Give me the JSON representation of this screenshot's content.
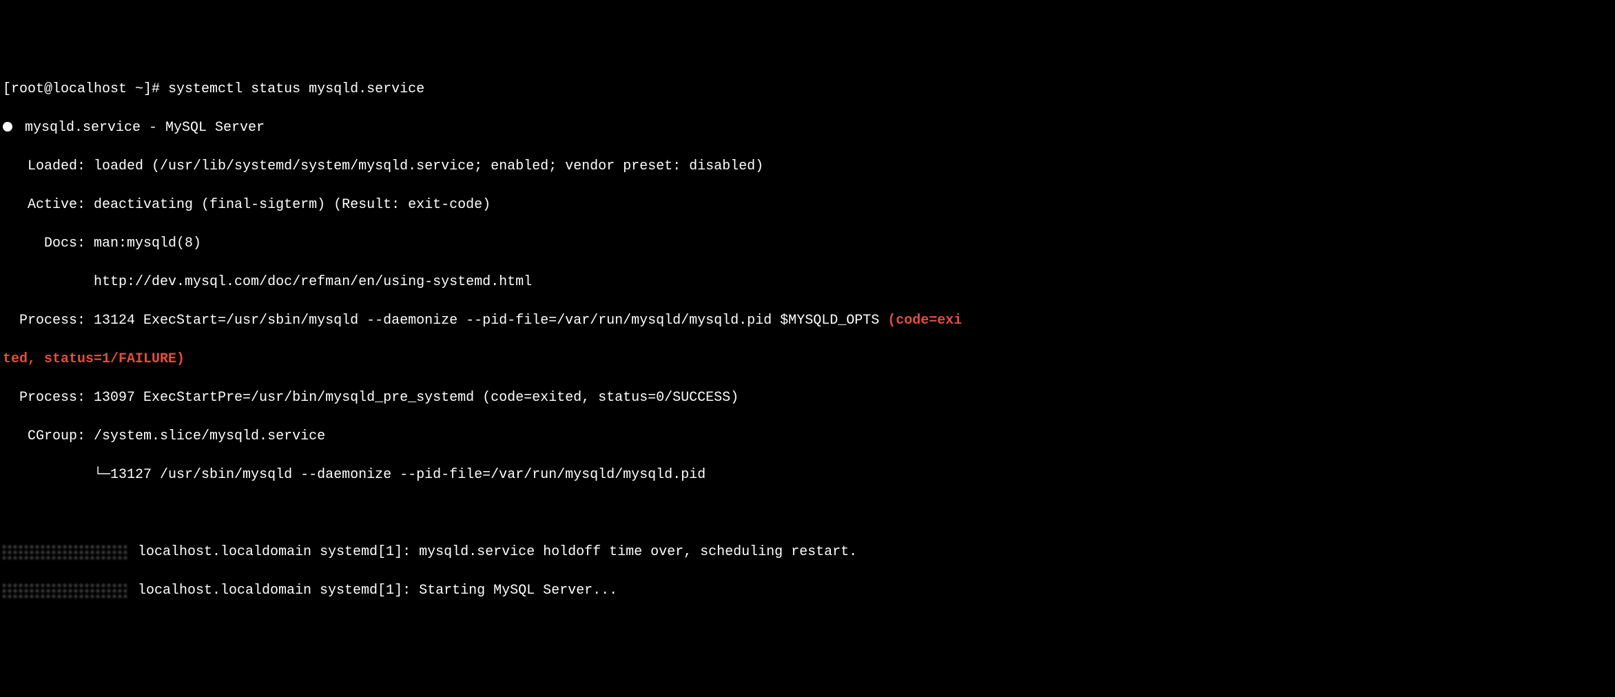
{
  "prompt": "[root@localhost ~]# ",
  "command": "systemctl status mysqld.service",
  "service_line": " mysqld.service - MySQL Server",
  "loaded": "   Loaded: loaded (/usr/lib/systemd/system/mysqld.service; enabled; vendor preset: disabled)",
  "active": "   Active: deactivating (final-sigterm) (Result: exit-code)",
  "docs1": "     Docs: man:mysqld(8)",
  "docs2": "           http://dev.mysql.com/doc/refman/en/using-systemd.html",
  "process1a": "  Process: 13124 ExecStart=/usr/sbin/mysqld --daemonize --pid-file=/var/run/mysqld/mysqld.pid $MYSQLD_OPTS ",
  "process1b": "(code=exi",
  "process1c": "ted, status=1/FAILURE)",
  "process2": "  Process: 13097 ExecStartPre=/usr/bin/mysqld_pre_systemd (code=exited, status=0/SUCCESS)",
  "cgroup": "   CGroup: /system.slice/mysqld.service",
  "cgroup_child": "           └─13127 /usr/sbin/mysqld --daemonize --pid-file=/var/run/mysqld/mysqld.pid",
  "log1": " localhost.localdomain systemd[1]: mysqld.service holdoff time over, scheduling restart.",
  "log2": " localhost.localdomain systemd[1]: Starting MySQL Server..."
}
